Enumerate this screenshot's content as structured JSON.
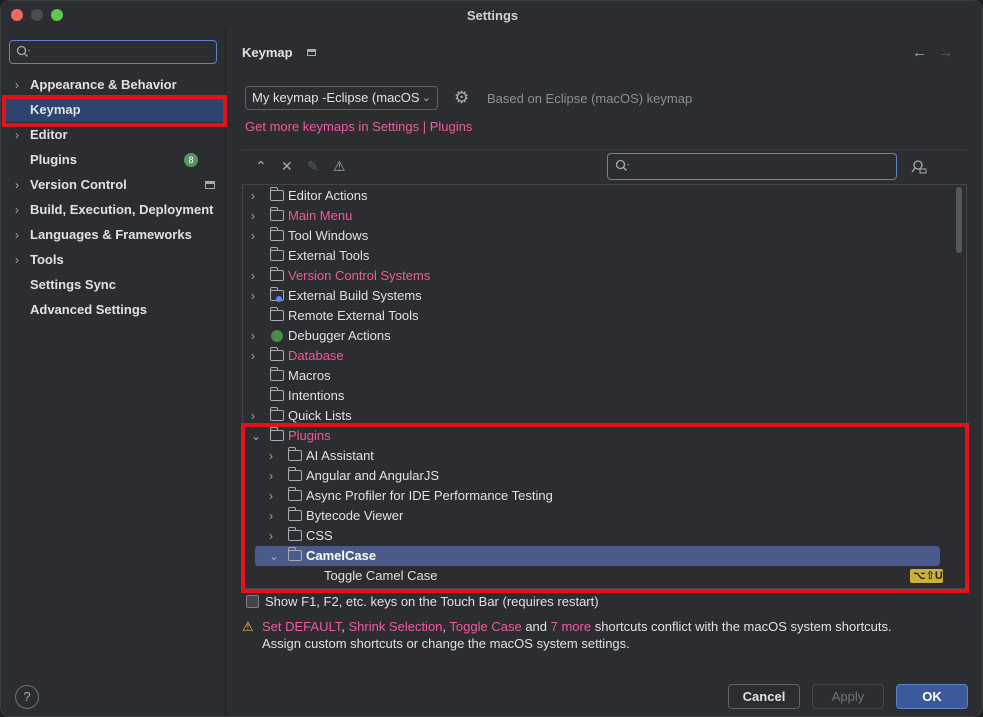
{
  "window": {
    "title": "Settings"
  },
  "sidebar": {
    "search_placeholder": "",
    "items": [
      {
        "label": "Appearance & Behavior",
        "expandable": true
      },
      {
        "label": "Keymap",
        "expandable": false,
        "selected": true
      },
      {
        "label": "Editor",
        "expandable": true
      },
      {
        "label": "Plugins",
        "expandable": false,
        "badge": "8"
      },
      {
        "label": "Version Control",
        "expandable": true
      },
      {
        "label": "Build, Execution, Deployment",
        "expandable": true
      },
      {
        "label": "Languages & Frameworks",
        "expandable": true
      },
      {
        "label": "Tools",
        "expandable": true
      },
      {
        "label": "Settings Sync",
        "expandable": false
      },
      {
        "label": "Advanced Settings",
        "expandable": false
      }
    ],
    "help_label": "?"
  },
  "header": {
    "title": "Keymap",
    "back_icon": "←",
    "forward_icon": "→"
  },
  "keymap": {
    "selected": "My keymap -Eclipse (macOS)",
    "based_on": "Based on Eclipse (macOS) keymap",
    "get_more": "Get more keymaps in Settings | Plugins"
  },
  "toolbar": {
    "expand_all_icon": "⌃",
    "collapse_all_icon": "⨯",
    "edit_icon": "✎",
    "conflicts_icon": "⚠",
    "search_placeholder": "",
    "find_shortcut_icon": "⍝"
  },
  "tree": [
    {
      "label": "Editor Actions",
      "chevron": "›",
      "folder": true
    },
    {
      "label": "Main Menu",
      "chevron": "›",
      "folder": true,
      "highlight": true
    },
    {
      "label": "Tool Windows",
      "chevron": "›",
      "folder": true
    },
    {
      "label": "External Tools",
      "chevron": "",
      "folder": true
    },
    {
      "label": "Version Control Systems",
      "chevron": "›",
      "folder": true,
      "highlight": true
    },
    {
      "label": "External Build Systems",
      "chevron": "›",
      "folder": true
    },
    {
      "label": "Remote External Tools",
      "chevron": "",
      "folder": true
    },
    {
      "label": "Debugger Actions",
      "chevron": "›",
      "folder": false
    },
    {
      "label": "Database",
      "chevron": "›",
      "folder": true,
      "highlight": true
    },
    {
      "label": "Macros",
      "chevron": "",
      "folder": true
    },
    {
      "label": "Intentions",
      "chevron": "",
      "folder": true
    },
    {
      "label": "Quick Lists",
      "chevron": "›",
      "folder": true
    },
    {
      "label": "Plugins",
      "chevron": "⌄",
      "folder": true,
      "highlight": true
    },
    {
      "label": "AI Assistant",
      "chevron": "›",
      "folder": true
    },
    {
      "label": "Angular and AngularJS",
      "chevron": "›",
      "folder": true
    },
    {
      "label": "Async Profiler for IDE Performance Testing",
      "chevron": "›",
      "folder": true
    },
    {
      "label": "Bytecode Viewer",
      "chevron": "›",
      "folder": true
    },
    {
      "label": "CSS",
      "chevron": "›",
      "folder": true
    },
    {
      "label": "CamelCase",
      "chevron": "⌄",
      "folder": true,
      "selected": true
    },
    {
      "label": "Toggle Camel Case",
      "chevron": "",
      "folder": false,
      "shortcut": "⌥⇧U"
    }
  ],
  "touchbar": {
    "label": "Show F1, F2, etc. keys on the Touch Bar (requires restart)",
    "checked": false
  },
  "warning": {
    "icon": "⚠",
    "set_default": "Set DEFAULT",
    "comma1": ", ",
    "shrink": "Shrink Selection",
    "comma2": ", ",
    "toggle": "Toggle Case",
    "and": " and ",
    "more": "7 more",
    "rest": " shortcuts conflict with the macOS system shortcuts.",
    "line2": "Assign custom shortcuts or change the macOS system settings."
  },
  "buttons": {
    "cancel": "Cancel",
    "apply": "Apply",
    "ok": "OK"
  },
  "colors": {
    "accent": "#ef5aa1",
    "selection": "#2e436e",
    "highlight_box": "#e3131b",
    "ok_button": "#3c5a9b"
  }
}
